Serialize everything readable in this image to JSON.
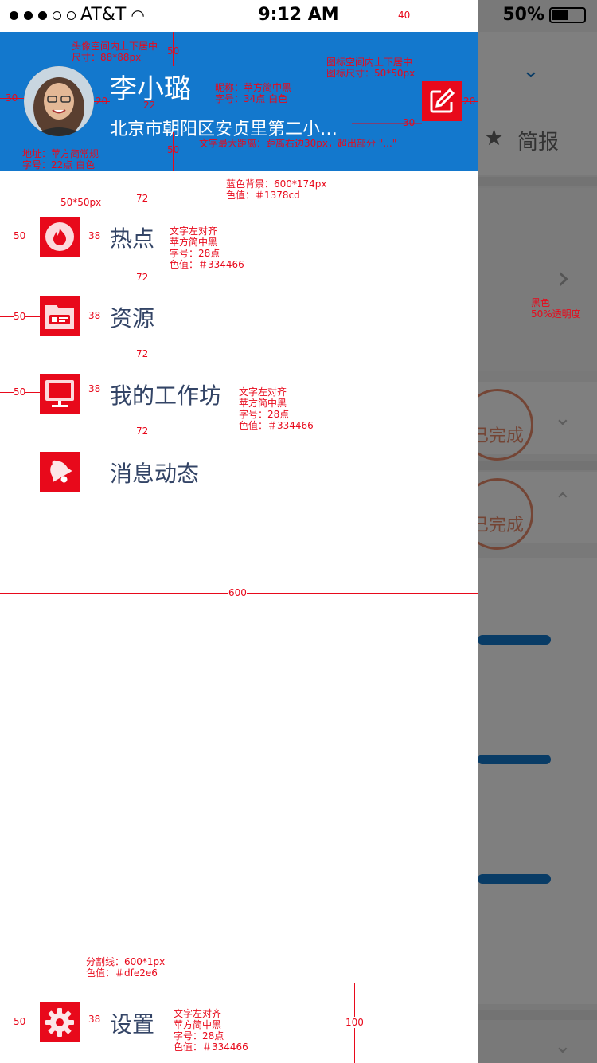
{
  "status_bar": {
    "carrier": "AT&T",
    "time": "9:12 AM",
    "battery": "50%"
  },
  "header": {
    "nickname": "李小璐",
    "address": "北京市朝阳区安贞里第二小学...",
    "bg_color": "#1378cd"
  },
  "menu": [
    {
      "label": "热点",
      "icon": "fire-icon"
    },
    {
      "label": "资源",
      "icon": "folder-card-icon"
    },
    {
      "label": "我的工作坊",
      "icon": "monitor-icon"
    },
    {
      "label": "消息动态",
      "icon": "bell-icon"
    }
  ],
  "settings": {
    "label": "设置",
    "icon": "gear-icon"
  },
  "underlay": {
    "tab_label": "简报",
    "stamp_text": "已完成"
  },
  "annotations": {
    "avatar_note": [
      "头像空间内上下居中",
      "尺寸：88*88px"
    ],
    "nickname_note": [
      "昵称：苹方简中黑",
      "字号：34点  白色"
    ],
    "edit_note": [
      "图标空间内上下居中",
      "图标尺寸：50*50px"
    ],
    "address_note": [
      "地址：苹方简常规",
      "字号：22点  白色"
    ],
    "maxwidth_note": "文字最大距离：距离右边30px，超出部分 \"...\"",
    "bg_note": [
      "蓝色背景：600*174px",
      "色值：＃1378cd"
    ],
    "icon_size_note": "50*50px",
    "text_note_1": [
      "文字左对齐",
      "苹方简中黑",
      "字号：28点",
      "色值：＃334466"
    ],
    "text_note_2": [
      "文字左对齐",
      "苹方简中黑",
      "字号：28点",
      "色值：＃334466"
    ],
    "text_note_3": [
      "文字左对齐",
      "苹方简中黑",
      "字号：28点",
      "色值：＃334466"
    ],
    "overlay_note": [
      "黑色",
      "50%透明度"
    ],
    "divider_note": [
      "分割线：600*1px",
      "色值：＃dfe2e6"
    ],
    "nums": {
      "n40": "40",
      "n50": "50",
      "n30": "30",
      "n20": "20",
      "n22": "22",
      "n72": "72",
      "n38": "38",
      "n600": "600",
      "n100": "100"
    }
  }
}
